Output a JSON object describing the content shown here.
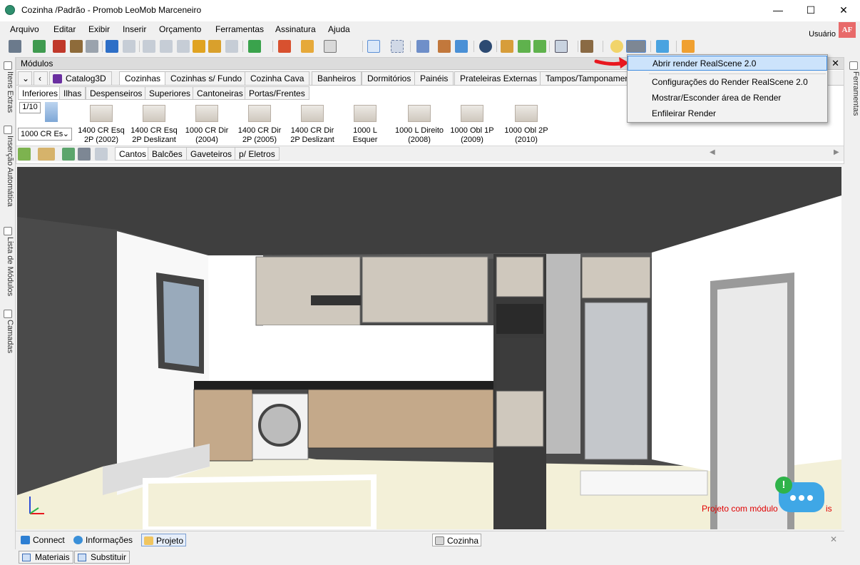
{
  "window": {
    "title": "Cozinha /Padrão - Promob LeoMob Marceneiro",
    "minimize": "—",
    "maximize": "☐",
    "close": "✕"
  },
  "menu": [
    "Arquivo",
    "Editar",
    "Exibir",
    "Inserir",
    "Orçamento",
    "Ferramentas",
    "Assinatura",
    "Ajuda"
  ],
  "user": {
    "label": "Usuário",
    "badge": "AF"
  },
  "left_panels": [
    "Itens Extras",
    "Inserção Automática",
    "Lista de Módulos",
    "Camadas"
  ],
  "right_panels": [
    "Ferramentas"
  ],
  "modules_panel": {
    "title": "Módulos",
    "close": "✕",
    "tabs": [
      "Catalog3D",
      "Cozinhas",
      "Cozinhas s/ Fundo",
      "Cozinha Cava",
      "Banheiros",
      "Dormitórios",
      "Painéis",
      "Prateleiras Externas",
      "Tampos/Tamponament"
    ],
    "active_tab": "Cozinhas",
    "subtabs": [
      "Inferiores",
      "Ilhas",
      "Despenseiros",
      "Superiores",
      "Cantoneiras",
      "Portas/Frentes"
    ],
    "active_subtab": "Inferiores",
    "page": "1/10",
    "combo_value": "1000 CR Es",
    "items": [
      {
        "l1": "1400 CR Esq",
        "l2": "2P (2002)"
      },
      {
        "l1": "1400 CR Esq",
        "l2": "2P Deslizant"
      },
      {
        "l1": "1000 CR Dir",
        "l2": "(2004)"
      },
      {
        "l1": "1400 CR Dir",
        "l2": "2P (2005)"
      },
      {
        "l1": "1400 CR Dir",
        "l2": "2P Deslizant"
      },
      {
        "l1": "1000 L",
        "l2": "Esquer"
      },
      {
        "l1": "1000 L Direito",
        "l2": "(2008)"
      },
      {
        "l1": "1000 Obl 1P",
        "l2": "(2009)"
      },
      {
        "l1": "1000 Obl 2P",
        "l2": "(2010)"
      }
    ],
    "bottom_tabs": [
      "Cantos",
      "Balcões",
      "Gaveteiros",
      "p/ Eletros"
    ],
    "active_bottom_tab": "Cantos",
    "scroll_left": "◀",
    "scroll_right": "▶"
  },
  "render_menu": {
    "items": [
      "Abrir render RealScene 2.0",
      "Configurações do Render RealScene 2.0",
      "Mostrar/Esconder área de Render",
      "Enfileirar Render"
    ],
    "highlighted": "Abrir render RealScene 2.0"
  },
  "viewport": {
    "warning": "Projeto com módulos inválidos",
    "warning_visible": "Projeto com módulo",
    "warning_tail": "is",
    "notify_badge": "!"
  },
  "status": {
    "items": [
      "Connect",
      "Informações",
      "Projeto"
    ],
    "active": "Projeto",
    "document_tab": "Cozinha",
    "close": "✕"
  },
  "bottom": [
    "Materiais",
    "Substituir"
  ],
  "colors": {
    "accent": "#3f8ce0",
    "arrow": "#e8171e",
    "badge": "#e86a6a",
    "chat": "#3fa7e6",
    "notify": "#2fb34a",
    "warning_text": "#e00000"
  }
}
